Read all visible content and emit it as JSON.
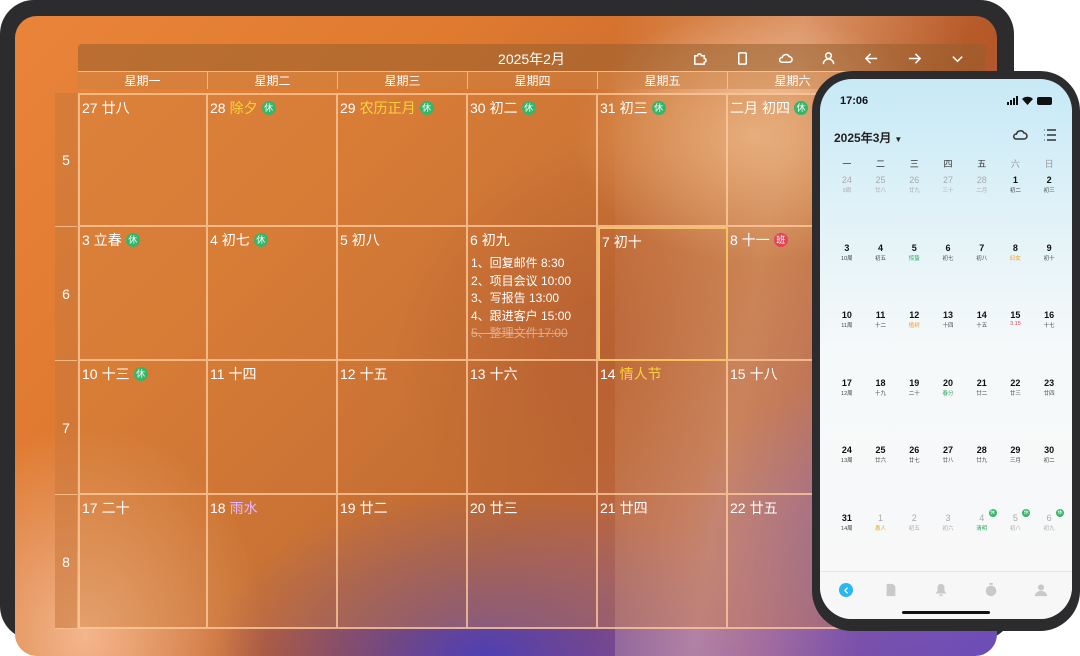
{
  "tablet": {
    "month_title": "2025年2月",
    "toolbar_icons": [
      "puzzle-icon",
      "tablet-icon",
      "cloud-icon",
      "user-icon",
      "arrow-left-icon",
      "arrow-right-icon",
      "chevron-down-icon"
    ],
    "weekdays": [
      "星期一",
      "星期二",
      "星期三",
      "星期四",
      "星期五",
      "星期六"
    ],
    "week_numbers": [
      "5",
      "6",
      "7",
      "8"
    ],
    "days": [
      {
        "d": "27",
        "lunar": "廿八",
        "style": "",
        "badge": ""
      },
      {
        "d": "28",
        "lunar": "除夕",
        "style": "hl",
        "badge": "休"
      },
      {
        "d": "29",
        "lunar": "农历正月",
        "style": "hl",
        "badge": "休"
      },
      {
        "d": "30",
        "lunar": "初二",
        "style": "",
        "badge": "休"
      },
      {
        "d": "31",
        "lunar": "初三",
        "style": "",
        "badge": "休"
      },
      {
        "d": "二月",
        "lunar": "初四",
        "style": "",
        "badge": "休"
      },
      {
        "d": "3",
        "lunar": "立春",
        "style": "",
        "badge": "休"
      },
      {
        "d": "4",
        "lunar": "初七",
        "style": "",
        "badge": "休"
      },
      {
        "d": "5",
        "lunar": "初八",
        "style": "",
        "badge": ""
      },
      {
        "d": "6",
        "lunar": "初九",
        "style": "",
        "badge": ""
      },
      {
        "d": "7",
        "lunar": "初十",
        "style": "",
        "badge": ""
      },
      {
        "d": "8",
        "lunar": "十一",
        "style": "",
        "badge": "班"
      },
      {
        "d": "10",
        "lunar": "十三",
        "style": "",
        "badge": "休"
      },
      {
        "d": "11",
        "lunar": "十四",
        "style": "",
        "badge": ""
      },
      {
        "d": "12",
        "lunar": "十五",
        "style": "",
        "badge": ""
      },
      {
        "d": "13",
        "lunar": "十六",
        "style": "",
        "badge": ""
      },
      {
        "d": "14",
        "lunar": "情人节",
        "style": "hl",
        "badge": ""
      },
      {
        "d": "15",
        "lunar": "十八",
        "style": "",
        "badge": ""
      },
      {
        "d": "17",
        "lunar": "二十",
        "style": "",
        "badge": ""
      },
      {
        "d": "18",
        "lunar": "雨水",
        "style": "pink",
        "badge": ""
      },
      {
        "d": "19",
        "lunar": "廿二",
        "style": "",
        "badge": ""
      },
      {
        "d": "20",
        "lunar": "廿三",
        "style": "",
        "badge": ""
      },
      {
        "d": "21",
        "lunar": "廿四",
        "style": "",
        "badge": ""
      },
      {
        "d": "22",
        "lunar": "廿五",
        "style": "",
        "badge": ""
      }
    ],
    "tasks": [
      {
        "text": "1、回复邮件 8:30",
        "done": false
      },
      {
        "text": "2、项目会议 10:00",
        "done": false
      },
      {
        "text": "3、写报告 13:00",
        "done": false
      },
      {
        "text": "4、跟进客户 15:00",
        "done": false
      },
      {
        "text": "5、整理文件17:00",
        "done": true
      }
    ]
  },
  "phone": {
    "time": "17:06",
    "month": "2025年3月",
    "weekdays": [
      "一",
      "二",
      "三",
      "四",
      "五",
      "六",
      "日"
    ],
    "rows": [
      [
        {
          "n": "24",
          "l": "9周",
          "dim": true
        },
        {
          "n": "25",
          "l": "廿八",
          "dim": true
        },
        {
          "n": "26",
          "l": "廿九",
          "dim": true
        },
        {
          "n": "27",
          "l": "三十",
          "dim": true
        },
        {
          "n": "28",
          "l": "二月",
          "dim": true
        },
        {
          "n": "1",
          "l": "初二"
        },
        {
          "n": "2",
          "l": "初三"
        }
      ],
      [
        {
          "n": "3",
          "l": "10周"
        },
        {
          "n": "4",
          "l": "初五"
        },
        {
          "n": "5",
          "l": "惊蛰",
          "c": "g"
        },
        {
          "n": "6",
          "l": "初七"
        },
        {
          "n": "7",
          "l": "初八"
        },
        {
          "n": "8",
          "l": "妇女",
          "c": "o"
        },
        {
          "n": "9",
          "l": "初十"
        }
      ],
      [
        {
          "n": "10",
          "l": "11周"
        },
        {
          "n": "11",
          "l": "十二"
        },
        {
          "n": "12",
          "l": "植树",
          "c": "o"
        },
        {
          "n": "13",
          "l": "十四"
        },
        {
          "n": "14",
          "l": "十五"
        },
        {
          "n": "15",
          "l": "3.15",
          "c": "r"
        },
        {
          "n": "16",
          "l": "十七"
        }
      ],
      [
        {
          "n": "17",
          "l": "12周"
        },
        {
          "n": "18",
          "l": "十九"
        },
        {
          "n": "19",
          "l": "二十"
        },
        {
          "n": "20",
          "l": "春分",
          "c": "g"
        },
        {
          "n": "21",
          "l": "廿二"
        },
        {
          "n": "22",
          "l": "廿三"
        },
        {
          "n": "23",
          "l": "廿四"
        }
      ],
      [
        {
          "n": "24",
          "l": "13周"
        },
        {
          "n": "25",
          "l": "廿六"
        },
        {
          "n": "26",
          "l": "廿七"
        },
        {
          "n": "27",
          "l": "廿八"
        },
        {
          "n": "28",
          "l": "廿九"
        },
        {
          "n": "29",
          "l": "三月"
        },
        {
          "n": "30",
          "l": "初二"
        }
      ],
      [
        {
          "n": "31",
          "l": "14周"
        },
        {
          "n": "1",
          "l": "愚人",
          "dim": true,
          "c": "o"
        },
        {
          "n": "2",
          "l": "初五",
          "dim": true
        },
        {
          "n": "3",
          "l": "初六",
          "dim": true
        },
        {
          "n": "4",
          "l": "清明",
          "dim": true,
          "c": "g",
          "rest": "休"
        },
        {
          "n": "5",
          "l": "初八",
          "dim": true,
          "rest": "休"
        },
        {
          "n": "6",
          "l": "初九",
          "dim": true,
          "rest": "休"
        }
      ]
    ],
    "tabbar": [
      "chevron-left-icon",
      "document-icon",
      "bell-icon",
      "timer-icon",
      "person-icon"
    ]
  },
  "colors": {
    "accent": "#29b8f0",
    "rest": "#35b66a",
    "work": "#e0455a",
    "highlight": "#ffd23b"
  }
}
